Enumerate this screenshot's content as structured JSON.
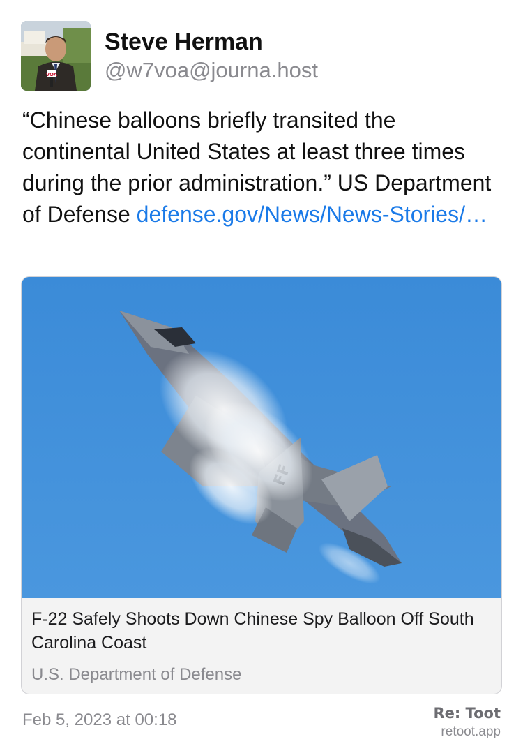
{
  "author": {
    "display_name": "Steve Herman",
    "handle": "@w7voa@journa.host",
    "avatar_badge": "VOA"
  },
  "post": {
    "text": "“Chinese balloons briefly transited the continental United States at least three times during the prior administration.” US Department of Defense ",
    "link_text": "defense.gov/News/News-Stories/…",
    "link_color": "#1a7ae8"
  },
  "link_card": {
    "image_icon": "f22-fighter-jet-image",
    "title": "F-22 Safely Shoots Down Chinese Spy Balloon Off South Carolina Coast",
    "source": "U.S. Department of Defense",
    "aircraft_tail_marking": "FF"
  },
  "footer": {
    "timestamp": "Feb 5, 2023 at 00:18",
    "brand_title": "Re: Toot",
    "brand_domain": "retoot.app"
  }
}
